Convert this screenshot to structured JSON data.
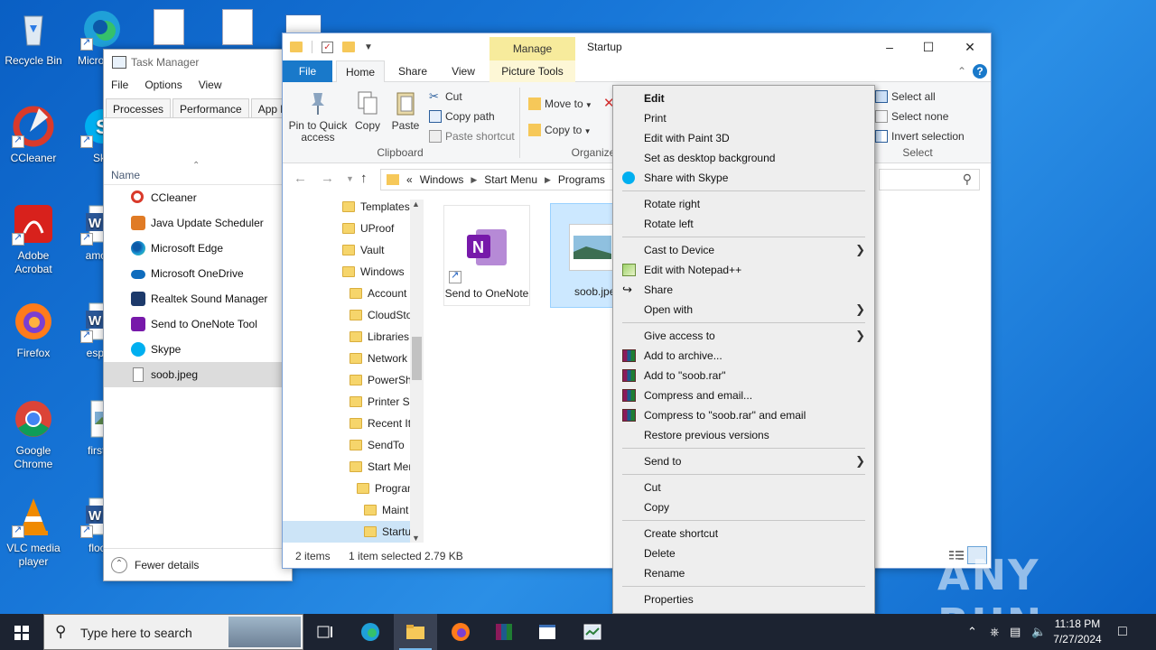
{
  "desktop": {
    "icons": [
      {
        "label": "Recycle Bin",
        "icon": "recycle-bin-icon"
      },
      {
        "label": "Micro Edg",
        "icon": "edge-icon"
      },
      {
        "label": "CCleaner",
        "icon": "ccleaner-icon"
      },
      {
        "label": "Sky",
        "icon": "skype-icon"
      },
      {
        "label": "Adobe Acrobat",
        "icon": "acrobat-icon"
      },
      {
        "label": "among",
        "icon": "word-doc-icon"
      },
      {
        "label": "Firefox",
        "icon": "firefox-icon"
      },
      {
        "label": "especi",
        "icon": "word-doc-icon"
      },
      {
        "label": "Google Chrome",
        "icon": "chrome-icon"
      },
      {
        "label": "firstco",
        "icon": "image-file-icon"
      },
      {
        "label": "VLC media player",
        "icon": "vlc-icon"
      },
      {
        "label": "floorg",
        "icon": "word-doc-icon"
      }
    ]
  },
  "task_manager": {
    "title": "Task Manager",
    "menu": [
      "File",
      "Options",
      "View"
    ],
    "tabs": [
      "Processes",
      "Performance",
      "App hist"
    ],
    "column_name": "Name",
    "rows": [
      {
        "label": "CCleaner",
        "icon": "ccleaner-icon"
      },
      {
        "label": "Java Update Scheduler",
        "icon": "java-icon"
      },
      {
        "label": "Microsoft Edge",
        "icon": "edge-icon"
      },
      {
        "label": "Microsoft OneDrive",
        "icon": "onedrive-icon"
      },
      {
        "label": "Realtek Sound Manager",
        "icon": "realtek-icon"
      },
      {
        "label": "Send to OneNote Tool",
        "icon": "onenote-icon"
      },
      {
        "label": "Skype",
        "icon": "skype-icon"
      },
      {
        "label": "soob.jpeg",
        "icon": "file-icon",
        "selected": true
      }
    ],
    "fewer_details": "Fewer details"
  },
  "explorer": {
    "title": "Startup",
    "manage_tab": "Manage",
    "tabs": {
      "file": "File",
      "home": "Home",
      "share": "Share",
      "view": "View",
      "picture_tools": "Picture Tools"
    },
    "ribbon": {
      "pin_to_quick_access": "Pin to Quick access",
      "copy": "Copy",
      "paste": "Paste",
      "cut": "Cut",
      "copy_path": "Copy path",
      "paste_shortcut": "Paste shortcut",
      "clipboard_group": "Clipboard",
      "move_to": "Move to",
      "copy_to": "Copy to",
      "organize_group": "Organize",
      "select_all": "Select all",
      "select_none": "Select none",
      "invert_selection": "Invert selection",
      "select_group": "Select"
    },
    "address": {
      "prefix": "«",
      "crumbs": [
        "Windows",
        "Start Menu",
        "Programs"
      ]
    },
    "tree": [
      {
        "label": "Templates",
        "indent": 0
      },
      {
        "label": "UProof",
        "indent": 0
      },
      {
        "label": "Vault",
        "indent": 0
      },
      {
        "label": "Windows",
        "indent": 0
      },
      {
        "label": "Account",
        "indent": 1
      },
      {
        "label": "CloudSto",
        "indent": 1
      },
      {
        "label": "Libraries",
        "indent": 1
      },
      {
        "label": "Network",
        "indent": 1
      },
      {
        "label": "PowerSh",
        "indent": 1
      },
      {
        "label": "Printer Sh",
        "indent": 1
      },
      {
        "label": "Recent It",
        "indent": 1
      },
      {
        "label": "SendTo",
        "indent": 1
      },
      {
        "label": "Start Men",
        "indent": 1
      },
      {
        "label": "Program",
        "indent": 2
      },
      {
        "label": "Maint",
        "indent": 3
      },
      {
        "label": "Startu",
        "indent": 3,
        "selected": true
      }
    ],
    "files": [
      {
        "label": "Send to OneNote",
        "icon": "onenote-icon"
      },
      {
        "label": "soob.jpeg",
        "icon": "image-file-icon",
        "selected": true
      }
    ],
    "status": {
      "items": "2 items",
      "selected": "1 item selected  2.79 KB"
    }
  },
  "context_menu": {
    "items": [
      {
        "label": "Edit",
        "bold": true
      },
      {
        "label": "Print"
      },
      {
        "label": "Edit with Paint 3D"
      },
      {
        "label": "Set as desktop background"
      },
      {
        "label": "Share with Skype",
        "icon": "skype-icon"
      },
      {
        "sep": true
      },
      {
        "label": "Rotate right"
      },
      {
        "label": "Rotate left"
      },
      {
        "sep": true
      },
      {
        "label": "Cast to Device",
        "submenu": true
      },
      {
        "label": "Edit with Notepad++",
        "icon": "notepadpp-icon"
      },
      {
        "label": "Share",
        "icon": "share-icon"
      },
      {
        "label": "Open with",
        "submenu": true
      },
      {
        "sep": true
      },
      {
        "label": "Give access to",
        "submenu": true
      },
      {
        "label": "Add to archive...",
        "icon": "winrar-icon"
      },
      {
        "label": "Add to \"soob.rar\"",
        "icon": "winrar-icon"
      },
      {
        "label": "Compress and email...",
        "icon": "winrar-icon"
      },
      {
        "label": "Compress to \"soob.rar\" and email",
        "icon": "winrar-icon"
      },
      {
        "label": "Restore previous versions"
      },
      {
        "sep": true
      },
      {
        "label": "Send to",
        "submenu": true
      },
      {
        "sep": true
      },
      {
        "label": "Cut"
      },
      {
        "label": "Copy"
      },
      {
        "sep": true
      },
      {
        "label": "Create shortcut"
      },
      {
        "label": "Delete"
      },
      {
        "label": "Rename"
      },
      {
        "sep": true
      },
      {
        "label": "Properties"
      }
    ]
  },
  "taskbar": {
    "search_placeholder": "Type here to search",
    "time": "11:18 PM",
    "date": "7/27/2024"
  },
  "watermark": "ANY RUN"
}
